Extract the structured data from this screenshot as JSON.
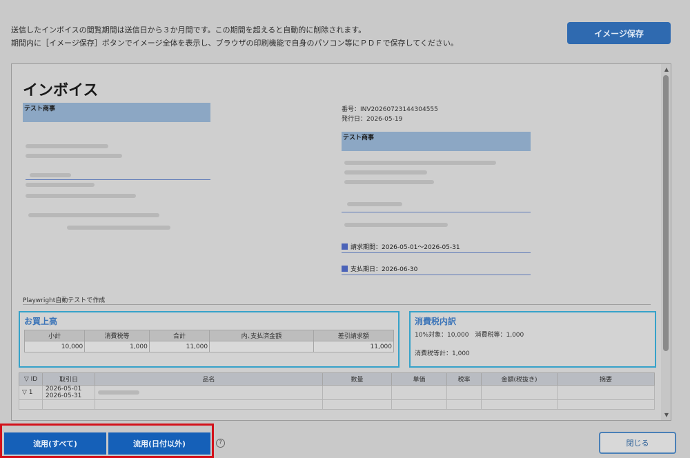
{
  "notice": {
    "line1": "送信したインボイスの閲覧期間は送信日から３か月間です。この期間を超えると自動的に削除されます。",
    "line2": "期間内に［イメージ保存］ボタンでイメージ全体を表示し、ブラウザの印刷機能で自身のパソコン等にＰＤＦで保存してください。"
  },
  "toolbar": {
    "save_image_label": "イメージ保存"
  },
  "invoice": {
    "title": "インボイス",
    "sender_name": "テスト商事",
    "number": "番号：INV20260723144304555",
    "issue_date": "発行日：2026-05-19",
    "recipient_name": "テスト商事",
    "billing_period": "請求期間：2026-05-01～2026-05-31",
    "payment_due": "支払期日：2026-06-30",
    "note": "Playwright自動テストで作成"
  },
  "purchase": {
    "title": "お買上高",
    "headers": [
      "小計",
      "消費税等",
      "合計",
      "内､支払済金額",
      "差引請求額"
    ],
    "values": [
      "10,000",
      "1,000",
      "11,000",
      "",
      "11,000"
    ]
  },
  "tax": {
    "title": "消費税内訳",
    "line1": "10%対象：10,000　消費税等：1,000",
    "line2": "消費税等計：1,000"
  },
  "details": {
    "headers": [
      "▽ ID",
      "取引日",
      "品名",
      "数量",
      "単価",
      "税率",
      "金額(税抜き)",
      "摘要"
    ],
    "rows": [
      {
        "id": "▽ 1",
        "date1": "2026-05-01",
        "date2": "2026-05-31"
      }
    ]
  },
  "footer": {
    "copy_all_label": "流用(すべて)",
    "copy_except_date_label": "流用(日付以外)",
    "help_label": "?",
    "close_label": "閉じる"
  }
}
